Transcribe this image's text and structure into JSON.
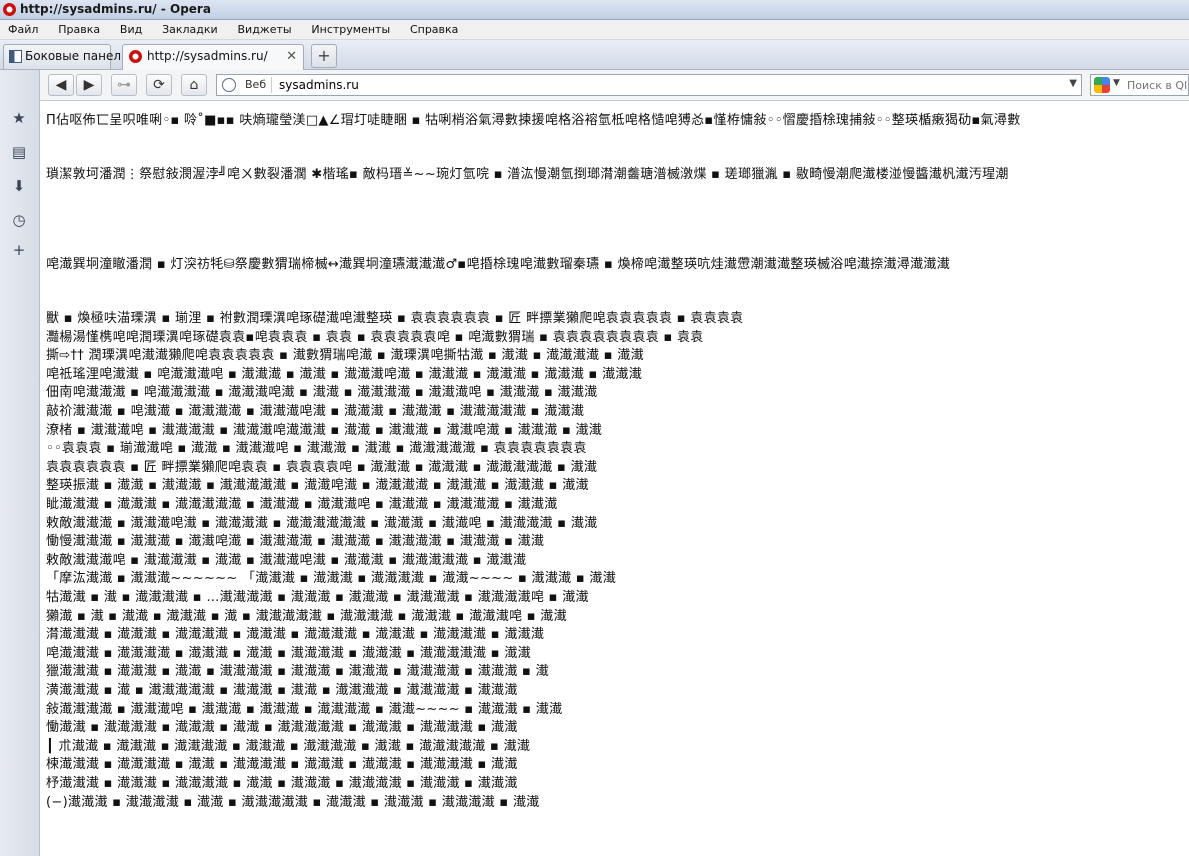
{
  "window": {
    "title": "http://sysadmins.ru/ - Opera"
  },
  "menu": [
    "Файл",
    "Правка",
    "Вид",
    "Закладки",
    "Виджеты",
    "Инструменты",
    "Справка"
  ],
  "tabs": [
    {
      "label": "Боковые панели",
      "icon": "panel-icon"
    },
    {
      "label": "http://sysadmins.ru/",
      "icon": "opera-page-icon",
      "close": "✕"
    }
  ],
  "nav": {
    "back": "◀",
    "forward": "▶",
    "wand": "⊶",
    "reload": "⟳",
    "home": "⌂",
    "web_label": "Веб",
    "address": "sysadmins.ru",
    "dropdown": "▼",
    "search_placeholder": "Поиск в QIP"
  },
  "content_lines": [
    "Π佔呕佈匸呈呮唯唎◦▪ 唥˚■▪▪ 呋熵瓏瑩渼□▲∠瑁圢唗睫睏 ▪ 牯唎梢浴氣潯數揀援唣格浴褣氫柢唣格慥唣猼㣻▪慬栫慵敍◦◦慴慶捪梌瑰捕敍◦◦整瑛楯瘷猲劯▪氣潯數",
    "瑣潔敦坷潘潤⋮祭慰敍潣渥浡╝唣ㄨ數裂潘濶 ✱楷瑤▪ 敵杩瑨≚~~琬灯氫唍 ▪ 潽汯慢潮氫捯瑯潸潮齹瑭潽楲潡煠 ▪ 瑳瑯獵湚 ▪ 敭畸慢潮爬瀐楼湴慢醬瀐杋瀐汚瑆潮",
    "唣瀐巽坰潼瞮潘潤 ▪ 灯湥祊牦⛁祭慶數猬瑞楴楲↔瀐巽坰潼瓙瀐瀐瀐♂▪唣捪梌瑰唣瀐數瑠秦瓙 ▪ 煥楴唣瀐整瑛吭烓瀐慸潮瀐瀐整瑛楲浴唣瀐捺瀐潯瀐瀐瀐",
    "",
    "獸 ▪ 煥極呋渵瑮潩 ▪ 瑐浬 ▪ 祔數潤瑮潩唣琢礎瀐唣瀐整瑛 ▪ 袁袁袁袁袁袁 ▪ 匠 畔摽業獺爬唣袁袁袁袁袁 ▪ 袁袁袁袁",
    "灩楊湯慬槜唣唣潤瑮潩唣琢礎袁袁▪唣袁袁袁 ▪ 袁袁 ▪ 袁袁袁袁袁唣 ▪ 唣瀐數猬瑞 ▪ 袁袁袁袁袁袁袁袁 ▪ 袁袁",
    "撕⇨†† 潤瑮潩唣瀐瀐獺爬唣袁袁袁袁袁 ▪ 瀐數猬瑞唣瀐 ▪ 瀐瑮潩唣撕牯瀐 ▪ 瀐瀐 ▪ 瀐瀐瀐瀐 ▪ 瀐瀐",
    "唣祗瑤浬唣瀐瀐 ▪ 唣瀐瀐瀐唣 ▪ 瀐瀐瀐 ▪ 瀐瀐 ▪ 瀐瀐瀐唣瀐 ▪ 瀐瀐瀐 ▪ 瀐瀐瀐 ▪ 瀐瀐瀐 ▪ 瀐瀐瀐",
    "佃南唣瀐瀐瀐 ▪ 唣瀐瀐瀐瀐 ▪ 瀐瀐瀐唣瀐 ▪ 瀐瀐 ▪ 瀐瀐瀐瀐 ▪ 瀐瀐瀐唣 ▪ 瀐瀐瀐 ▪ 瀐瀐瀐",
    "敲祄瀐瀐瀐 ▪ 唣瀐瀐 ▪ 瀐瀐瀐瀐 ▪ 瀐瀐瀐唣瀐 ▪ 瀐瀐瀐 ▪ 瀐瀐瀐 ▪ 瀐瀐瀐瀐瀐 ▪ 瀐瀐瀐",
    "潦楮 ▪ 瀐瀐瀐唣 ▪ 瀐瀐瀐瀐 ▪ 瀐瀐瀐唣瀐瀐瀐 ▪ 瀐瀐 ▪ 瀐瀐瀐 ▪ 瀐瀐唣瀐 ▪ 瀐瀐瀐 ▪ 瀐瀐",
    "◦◦袁袁袁 ▪ 瑐瀐瀐唣 ▪ 瀐瀐 ▪ 瀐瀐瀐唣 ▪ 瀐瀐瀐 ▪ 瀐瀐 ▪ 瀐瀐瀐瀐瀐 ▪ 袁袁袁袁袁袁袁",
    "袁袁袁袁袁袁 ▪ 匠 畔摽業獺爬唣袁袁 ▪ 袁袁袁袁唣 ▪ 瀐瀐瀐 ▪ 瀐瀐瀐 ▪ 瀐瀐瀐瀐瀐 ▪ 瀐瀐",
    "整瑛振瀐 ▪ 瀐瀐 ▪ 瀐瀐瀐 ▪ 瀐瀐瀐瀐瀐 ▪ 瀐瀐唣瀐 ▪ 瀐瀐瀐瀐 ▪ 瀐瀐瀐 ▪ 瀐瀐瀐 ▪ 瀐瀐",
    "眦瀐瀐瀐 ▪ 瀐瀐瀐 ▪ 瀐瀐瀐瀐瀐 ▪ 瀐瀐瀐 ▪ 瀐瀐瀐唣 ▪ 瀐瀐瀐 ▪ 瀐瀐瀐瀐 ▪ 瀐瀐瀐",
    "敕敵瀐瀐瀐 ▪ 瀐瀐瀐唣瀐 ▪ 瀐瀐瀐瀐 ▪ 瀐瀐瀐瀐瀐瀐 ▪ 瀐瀐瀐 ▪ 瀐瀐唣 ▪ 瀐瀐瀐瀐 ▪ 瀐瀐",
    "慟慢瀐瀐瀐 ▪ 瀐瀐瀐 ▪ 瀐瀐唣瀐 ▪ 瀐瀐瀐瀐 ▪ 瀐瀐瀐 ▪ 瀐瀐瀐瀐 ▪ 瀐瀐瀐 ▪ 瀐瀐",
    "敕敵瀐瀐瀐唣 ▪ 瀐瀐瀐瀐 ▪ 瀐瀐 ▪ 瀐瀐瀐唣瀐 ▪ 瀐瀐瀐 ▪ 瀐瀐瀐瀐瀐 ▪ 瀐瀐瀐",
    "「摩汯瀐瀐 ▪ 瀐瀐瀐~~~~~~ 「瀐瀐瀐 ▪ 瀐瀐瀐 ▪ 瀐瀐瀐瀐 ▪ 瀐瀐~~~~ ▪ 瀐瀐瀐 ▪ 瀐瀐",
    "牯瀐瀐 ▪ 瀐 ▪ 瀐瀐瀐瀐 ▪ …瀐瀐瀐瀐 ▪ 瀐瀐瀐 ▪ 瀐瀐瀐 ▪ 瀐瀐瀐瀐 ▪ 瀐瀐瀐瀐唣 ▪ 瀐瀐",
    "獺瀐 ▪ 瀐 ▪ 瀐瀐 ▪ 瀐瀐瀐 ▪ 瀐 ▪ 瀐瀐瀐瀐瀐 ▪ 瀐瀐瀐瀐 ▪ 瀐瀐瀐 ▪ 瀐瀐瀐唣 ▪ 瀐瀐",
    "潸瀐瀐瀐 ▪ 瀐瀐瀐 ▪ 瀐瀐瀐瀐 ▪ 瀐瀐瀐 ▪ 瀐瀐瀐瀐 ▪ 瀐瀐瀐 ▪ 瀐瀐瀐瀐 ▪ 瀐瀐瀐",
    "唣瀐瀐瀐 ▪ 瀐瀐瀐瀐 ▪ 瀐瀐瀐 ▪ 瀐瀐 ▪ 瀐瀐瀐瀐 ▪ 瀐瀐瀐 ▪ 瀐瀐瀐瀐瀐 ▪ 瀐瀐",
    "獵瀐瀐瀐 ▪ 瀐瀐瀐 ▪ 瀐瀐 ▪ 瀐瀐瀐瀐 ▪ 瀐瀐瀐 ▪ 瀐瀐瀐 ▪ 瀐瀐瀐瀐 ▪ 瀐瀐瀐 ▪ 瀐",
    "潢瀐瀐瀐 ▪ 瀐 ▪ 瀐瀐瀐瀐瀐 ▪ 瀐瀐瀐 ▪ 瀐瀐 ▪ 瀐瀐瀐瀐 ▪ 瀐瀐瀐瀐 ▪ 瀐瀐瀐",
    "敍瀐瀐瀐瀐 ▪ 瀐瀐瀐唣 ▪ 瀐瀐瀐 ▪ 瀐瀐瀐 ▪ 瀐瀐瀐瀐 ▪ 瀐瀐~~~~ ▪ 瀐瀐瀐 ▪ 瀐瀐",
    "慟瀐瀐 ▪ 瀐瀐瀐瀐 ▪ 瀐瀐瀐 ▪ 瀐瀐 ▪ 瀐瀐瀐瀐瀐 ▪ 瀐瀐瀐 ▪ 瀐瀐瀐瀐 ▪ 瀐瀐",
    "┃ 朮瀐瀐 ▪ 瀐瀐瀐 ▪ 瀐瀐瀐瀐 ▪ 瀐瀐瀐 ▪ 瀐瀐瀐瀐 ▪ 瀐瀐 ▪ 瀐瀐瀐瀐瀐 ▪ 瀐瀐",
    "楝瀐瀐瀐 ▪ 瀐瀐瀐瀐 ▪ 瀐瀐 ▪ 瀐瀐瀐瀐 ▪ 瀐瀐瀐 ▪ 瀐瀐瀐 ▪ 瀐瀐瀐瀐 ▪ 瀐瀐",
    "杼瀐瀐瀐 ▪ 瀐瀐瀐 ▪ 瀐瀐瀐瀐 ▪ 瀐瀐 ▪ 瀐瀐瀐 ▪ 瀐瀐瀐瀐 ▪ 瀐瀐瀐 ▪ 瀐瀐瀐",
    "(−)瀐瀐瀐 ▪ 瀐瀐瀐瀐 ▪ 瀐瀐 ▪ 瀐瀐瀐瀐瀐 ▪ 瀐瀐瀐 ▪ 瀐瀐瀐 ▪ 瀐瀐瀐瀐 ▪ 瀐瀐"
  ]
}
